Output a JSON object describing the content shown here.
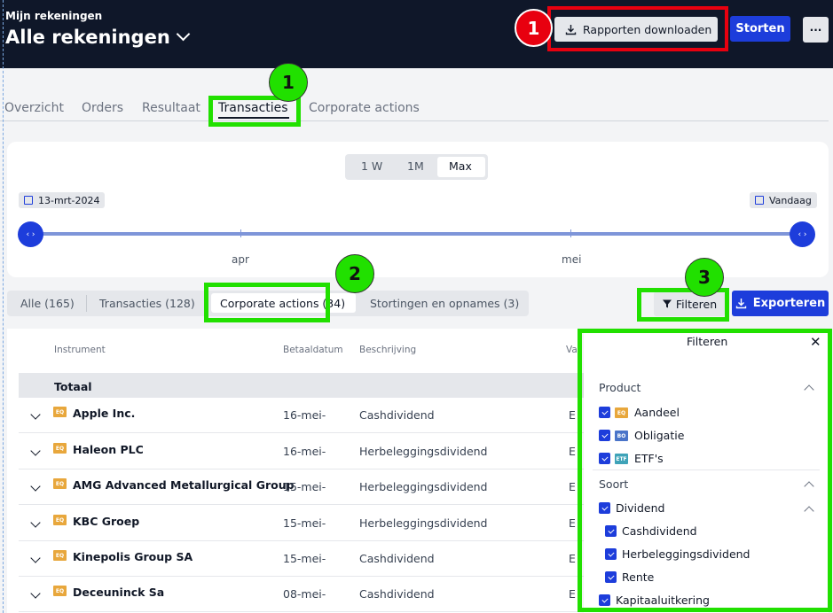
{
  "header": {
    "subtitle": "Mijn rekeningen",
    "title": "Alle rekeningen",
    "download_label": "Rapporten downloaden",
    "deposit_label": "Storten",
    "more_label": "···"
  },
  "annotations": [
    "1",
    "1",
    "2",
    "3"
  ],
  "tabs": [
    "Overzicht",
    "Orders",
    "Resultaat",
    "Transacties",
    "Corporate actions"
  ],
  "period": {
    "options": [
      "1 W",
      "1M",
      "Max"
    ],
    "start_date": "13-mrt-2024",
    "end_label": "Vandaag",
    "months": [
      "apr",
      "mei"
    ]
  },
  "filter_tabs": [
    "Alle (165)",
    "Transacties (128)",
    "Corporate actions (34)",
    "Stortingen en opnames (3)"
  ],
  "actions": {
    "filter_label": "Filteren",
    "export_label": "Exporteren"
  },
  "table": {
    "headers": [
      "Instrument",
      "Betaaldatum",
      "Beschrijving",
      "Va"
    ],
    "total_label": "Totaal",
    "rows": [
      {
        "badge": "EQ",
        "name": "Apple Inc.",
        "date": "16-mei-",
        "desc": "Cashdividend",
        "cur": "E"
      },
      {
        "badge": "EQ",
        "name": "Haleon PLC",
        "date": "16-mei-",
        "desc": "Herbeleggingsdividend",
        "cur": "E"
      },
      {
        "badge": "EQ",
        "name": "AMG Advanced Metallurgical Group",
        "date": "15-mei-",
        "desc": "Herbeleggingsdividend",
        "cur": "E"
      },
      {
        "badge": "EQ",
        "name": "KBC Groep",
        "date": "15-mei-",
        "desc": "Herbeleggingsdividend",
        "cur": "E"
      },
      {
        "badge": "EQ",
        "name": "Kinepolis Group SA",
        "date": "15-mei-",
        "desc": "Cashdividend",
        "cur": "E"
      },
      {
        "badge": "EQ",
        "name": "Deceuninck Sa",
        "date": "08-mei-",
        "desc": "Cashdividend",
        "cur": "E"
      }
    ]
  },
  "filter_panel": {
    "title": "Filteren",
    "close": "✕",
    "product_title": "Product",
    "products": [
      {
        "badge": "EQ",
        "label": "Aandeel"
      },
      {
        "badge": "BO",
        "label": "Obligatie"
      },
      {
        "badge": "ETF",
        "label": "ETF's"
      }
    ],
    "soort_title": "Soort",
    "dividend_label": "Dividend",
    "dividend_items": [
      "Cashdividend",
      "Herbeleggingsdividend",
      "Rente"
    ],
    "capital_label": "Kapitaaluitkering"
  },
  "colors": {
    "header_bg": "#0f1729",
    "primary": "#1d3ddb",
    "highlight_green": "#21e000",
    "highlight_red": "#e8000f",
    "equity_badge": "#e8a73c",
    "bond_badge": "#4a74c9",
    "etf_badge": "#3fa3b8"
  }
}
